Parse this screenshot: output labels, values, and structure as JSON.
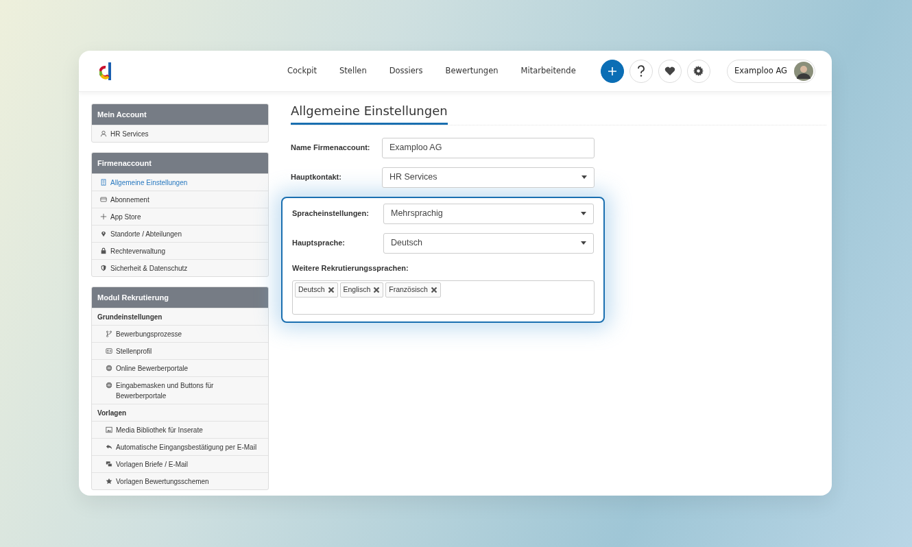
{
  "nav": {
    "links": [
      {
        "label": "Cockpit",
        "selected": false
      },
      {
        "label": "Stellen",
        "selected": false
      },
      {
        "label": "Dossiers",
        "selected": false
      },
      {
        "label": "Bewertungen",
        "selected": false
      },
      {
        "label": "Mitarbeitende",
        "selected": false
      }
    ],
    "account": "Examploo AG"
  },
  "sidebar": [
    {
      "title": "Mein Account",
      "items": [
        {
          "kind": "link",
          "label": "HR Services",
          "selected": false
        }
      ]
    },
    {
      "title": "Firmenaccount",
      "items": [
        {
          "kind": "link",
          "label": "Allgemeine Einstellungen",
          "selected": true
        },
        {
          "kind": "link",
          "label": "Abonnement",
          "selected": false
        },
        {
          "kind": "link",
          "label": "App Store",
          "selected": false
        },
        {
          "kind": "link",
          "label": "Standorte / Abteilungen",
          "selected": false
        },
        {
          "kind": "link",
          "label": "Rechteverwaltung",
          "selected": false
        },
        {
          "kind": "link",
          "label": "Sicherheit & Datenschutz",
          "selected": false
        }
      ]
    },
    {
      "title": "Modul Rekrutierung",
      "items": [
        {
          "kind": "subheader",
          "label": "Grundeinstellungen"
        },
        {
          "kind": "link",
          "label": "Bewerbungsprozesse",
          "selected": false
        },
        {
          "kind": "link",
          "label": "Stellenprofil",
          "selected": false
        },
        {
          "kind": "link",
          "label": "Online Bewerberportale",
          "selected": false
        },
        {
          "kind": "link",
          "label": "Eingabemasken und Buttons für Bewerberportale",
          "selected": false
        },
        {
          "kind": "subheader",
          "label": "Vorlagen"
        },
        {
          "kind": "link",
          "label": "Media Bibliothek für Inserate",
          "selected": false
        },
        {
          "kind": "link",
          "label": "Automatische Eingangsbestätigung per E-Mail",
          "selected": false
        },
        {
          "kind": "link",
          "label": "Vorlagen Briefe / E-Mail",
          "selected": false
        },
        {
          "kind": "link",
          "label": "Vorlagen Bewertungsschemen",
          "selected": false
        }
      ]
    }
  ],
  "page_title": "Allgemeine Einstellungen",
  "fields": [
    {
      "kind": "text",
      "label": "Name Firmenaccount:",
      "value": "Examploo AG"
    },
    {
      "kind": "select",
      "label": "Hauptkontakt:",
      "value": "HR Services"
    }
  ],
  "highlighted_fields": [
    {
      "kind": "select",
      "label": "Spracheinstellungen:",
      "value": "Mehrsprachig"
    },
    {
      "kind": "select",
      "label": "Hauptsprache:",
      "value": "Deutsch"
    },
    {
      "kind": "tags",
      "label": "Weitere Rekrutierungssprachen:",
      "tags": [
        "Deutsch",
        "Englisch",
        "Französisch"
      ]
    }
  ]
}
